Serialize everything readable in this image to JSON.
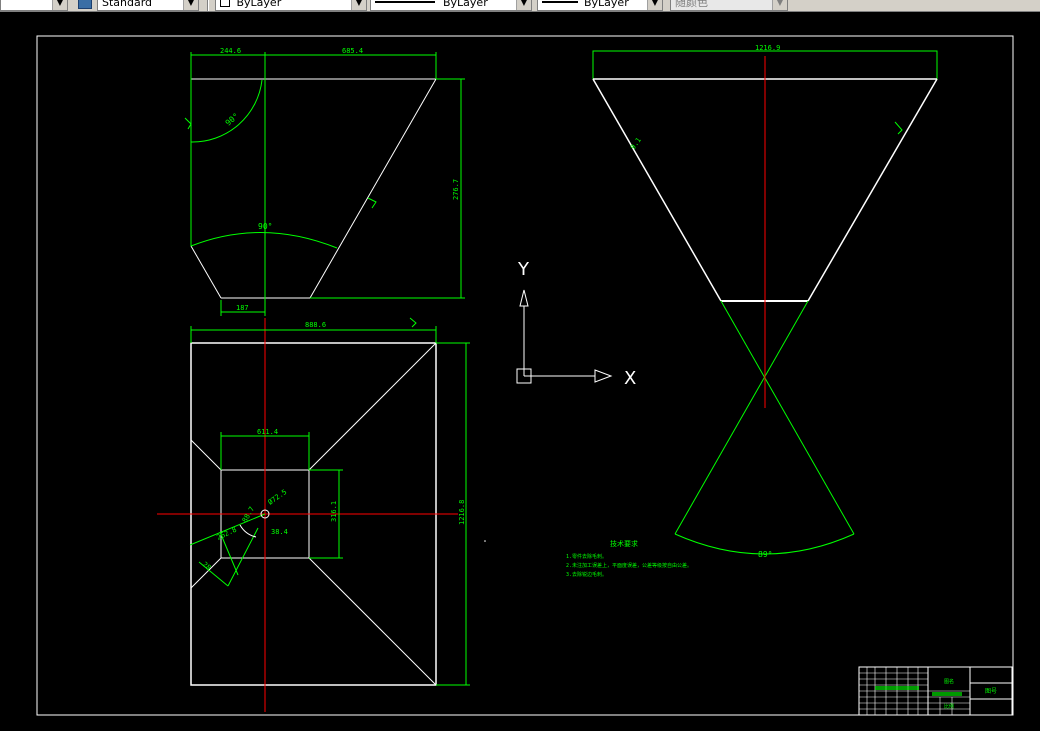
{
  "toolbar": {
    "text_style": "Standard",
    "layer": "ByLayer",
    "linetype": "ByLayer",
    "lineweight": "ByLayer",
    "color": "随颜色"
  },
  "dims": {
    "top_left_width": "244.6",
    "top_right_width": "685.4",
    "angle_top": "90°",
    "angle_arc_mid": "90°",
    "right_height": "276.7",
    "bottom_small": "187",
    "plan_top": "888.6",
    "plan_side": "1216.8",
    "inner_top": "611.4",
    "inner_side": "316.1",
    "inner_bottom": "38.4",
    "diag_a": "Ø72.5",
    "diag_b": "262.8",
    "diag_c": "88.7",
    "diag_d": "28",
    "cone_top": "1216.9",
    "cone_side": "9.1",
    "cone_arc": "89°"
  },
  "ucs": {
    "y_label": "Y",
    "x_label": "X"
  },
  "notes": {
    "title": "技术要求",
    "line1": "1.零件去除毛刺。",
    "line2": "2.未注加工误差上，平面度误差，公差等级按自由公差。",
    "line3": "3.去除锐边毛刺。"
  },
  "title_block": {
    "cell_a": "图名",
    "cell_b": "比例",
    "cell_c": "图号"
  },
  "colors": {
    "background": "#000000",
    "geometry": "#ffffff",
    "dimension": "#00ff00",
    "centerline": "#ff0000"
  }
}
